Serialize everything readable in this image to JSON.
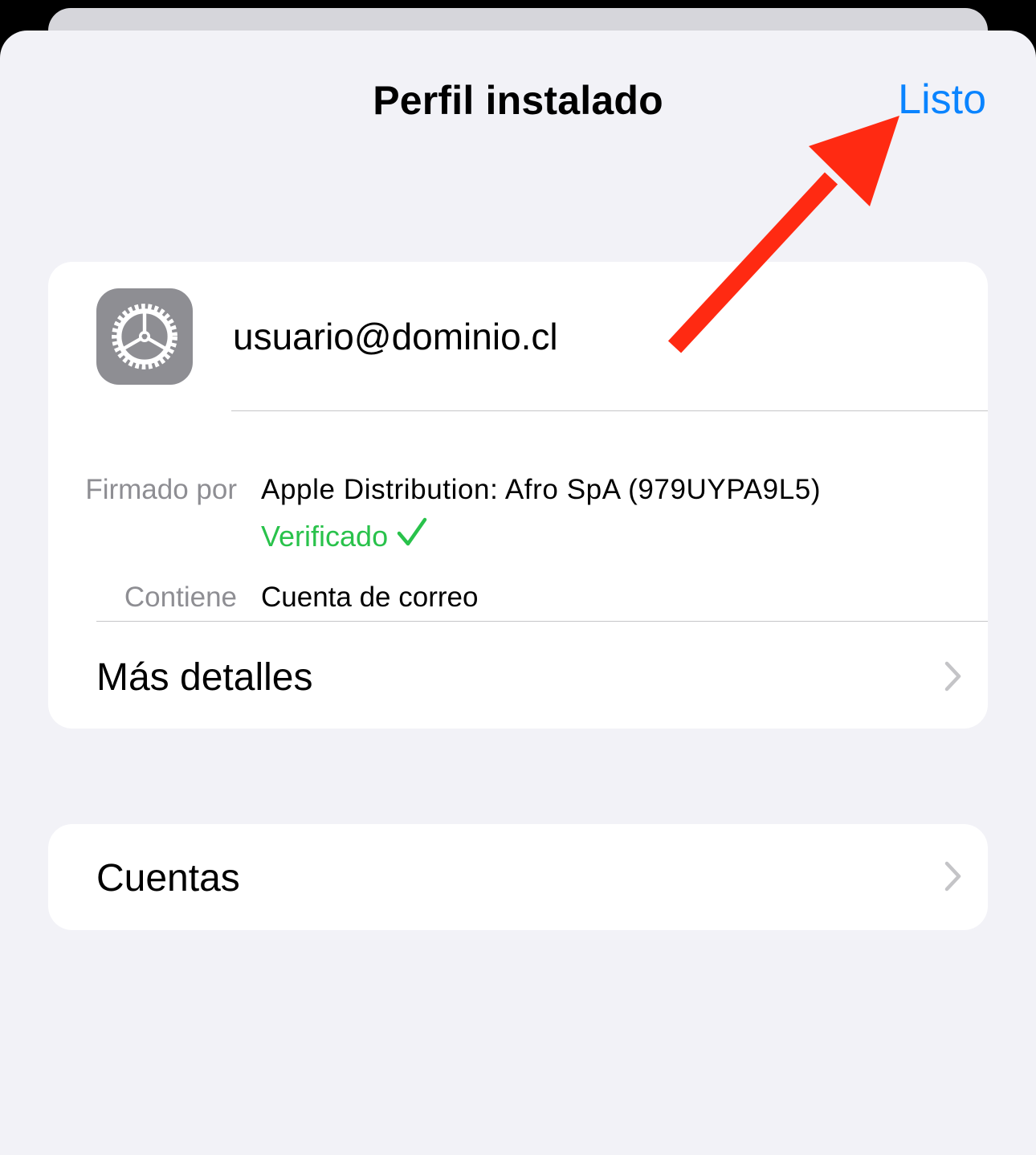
{
  "nav": {
    "title": "Perfil instalado",
    "done_label": "Listo"
  },
  "profile": {
    "icon": "gear-icon",
    "name": "usuario@dominio.cl",
    "signed_by_label": "Firmado por",
    "signed_by_value": "Apple Distribution: Afro SpA (979UYPA9L5)",
    "verified_label": "Verificado",
    "contains_label": "Contiene",
    "contains_value": "Cuenta de correo",
    "more_details_label": "Más detalles"
  },
  "accounts": {
    "label": "Cuentas"
  },
  "annotation": {
    "icon": "red-arrow-icon",
    "color": "#ff2a12"
  },
  "colors": {
    "accent": "#0a84ff",
    "verified": "#29c24b",
    "background": "#f2f2f7",
    "secondary_text": "#8e8e93"
  }
}
